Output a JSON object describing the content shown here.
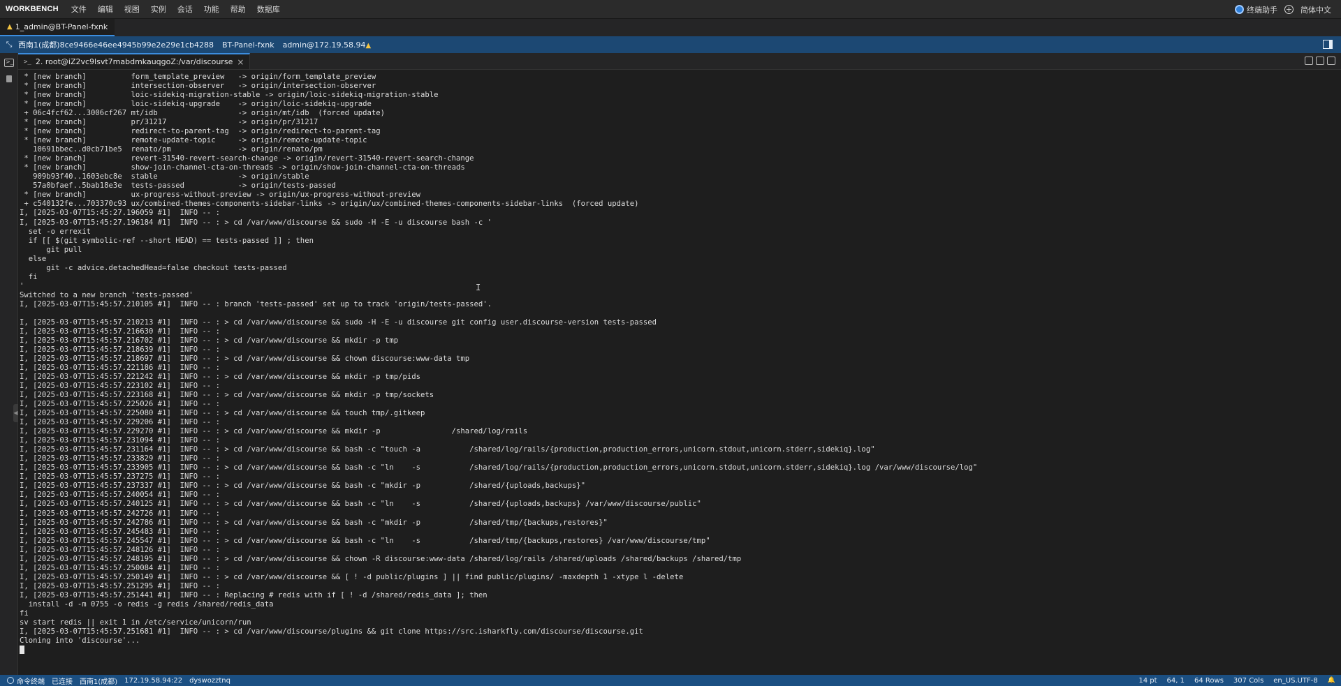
{
  "app": {
    "brand": "WORKBENCH",
    "menu": [
      "文件",
      "编辑",
      "视图",
      "实例",
      "会话",
      "功能",
      "帮助",
      "数据库"
    ],
    "assistant_label": "终端助手",
    "language": "简体中文"
  },
  "session_tab": {
    "label": "1_admin@BT-Panel-fxnk"
  },
  "infobar": {
    "region_instance": "西南1(成都)8ce9466e46ee4945b99e2e29e1cb4288",
    "panel_name": "BT-Panel-fxnk",
    "user_ip": "admin@172.19.58.94"
  },
  "terminal_tab": {
    "prompt": ">_",
    "label": "2. root@iZ2vc9lsvt7mabdmkauqgoZ:/var/discourse"
  },
  "terminal": {
    "lines": [
      " * [new branch]          form_template_preview   -> origin/form_template_preview",
      " * [new branch]          intersection-observer   -> origin/intersection-observer",
      " * [new branch]          loic-sidekiq-migration-stable -> origin/loic-sidekiq-migration-stable",
      " * [new branch]          loic-sidekiq-upgrade    -> origin/loic-sidekiq-upgrade",
      " + 06c4fcf62...3006cf267 mt/idb                  -> origin/mt/idb  (forced update)",
      " * [new branch]          pr/31217                -> origin/pr/31217",
      " * [new branch]          redirect-to-parent-tag  -> origin/redirect-to-parent-tag",
      " * [new branch]          remote-update-topic     -> origin/remote-update-topic",
      "   10691bbec..d0cb71be5  renato/pm               -> origin/renato/pm",
      " * [new branch]          revert-31540-revert-search-change -> origin/revert-31540-revert-search-change",
      " * [new branch]          show-join-channel-cta-on-threads -> origin/show-join-channel-cta-on-threads",
      "   909b93f40..1603ebc8e  stable                  -> origin/stable",
      "   57a0bfaef..5bab18e3e  tests-passed            -> origin/tests-passed",
      " * [new branch]          ux-progress-without-preview -> origin/ux-progress-without-preview",
      " + c540132fe...703370c93 ux/combined-themes-components-sidebar-links -> origin/ux/combined-themes-components-sidebar-links  (forced update)",
      "I, [2025-03-07T15:45:27.196059 #1]  INFO -- : ",
      "I, [2025-03-07T15:45:27.196184 #1]  INFO -- : > cd /var/www/discourse && sudo -H -E -u discourse bash -c '",
      "  set -o errexit",
      "  if [[ $(git symbolic-ref --short HEAD) == tests-passed ]] ; then",
      "      git pull",
      "  else",
      "      git -c advice.detachedHead=false checkout tests-passed",
      "  fi",
      "'",
      "Switched to a new branch 'tests-passed'",
      "I, [2025-03-07T15:45:57.210105 #1]  INFO -- : branch 'tests-passed' set up to track 'origin/tests-passed'.",
      "",
      "I, [2025-03-07T15:45:57.210213 #1]  INFO -- : > cd /var/www/discourse && sudo -H -E -u discourse git config user.discourse-version tests-passed",
      "I, [2025-03-07T15:45:57.216630 #1]  INFO -- : ",
      "I, [2025-03-07T15:45:57.216702 #1]  INFO -- : > cd /var/www/discourse && mkdir -p tmp",
      "I, [2025-03-07T15:45:57.218639 #1]  INFO -- : ",
      "I, [2025-03-07T15:45:57.218697 #1]  INFO -- : > cd /var/www/discourse && chown discourse:www-data tmp",
      "I, [2025-03-07T15:45:57.221186 #1]  INFO -- : ",
      "I, [2025-03-07T15:45:57.221242 #1]  INFO -- : > cd /var/www/discourse && mkdir -p tmp/pids",
      "I, [2025-03-07T15:45:57.223102 #1]  INFO -- : ",
      "I, [2025-03-07T15:45:57.223168 #1]  INFO -- : > cd /var/www/discourse && mkdir -p tmp/sockets",
      "I, [2025-03-07T15:45:57.225026 #1]  INFO -- : ",
      "I, [2025-03-07T15:45:57.225080 #1]  INFO -- : > cd /var/www/discourse && touch tmp/.gitkeep",
      "I, [2025-03-07T15:45:57.229206 #1]  INFO -- : ",
      "I, [2025-03-07T15:45:57.229270 #1]  INFO -- : > cd /var/www/discourse && mkdir -p                /shared/log/rails",
      "I, [2025-03-07T15:45:57.231094 #1]  INFO -- : ",
      "I, [2025-03-07T15:45:57.231164 #1]  INFO -- : > cd /var/www/discourse && bash -c \"touch -a           /shared/log/rails/{production,production_errors,unicorn.stdout,unicorn.stderr,sidekiq}.log\"",
      "I, [2025-03-07T15:45:57.233829 #1]  INFO -- : ",
      "I, [2025-03-07T15:45:57.233905 #1]  INFO -- : > cd /var/www/discourse && bash -c \"ln    -s           /shared/log/rails/{production,production_errors,unicorn.stdout,unicorn.stderr,sidekiq}.log /var/www/discourse/log\"",
      "I, [2025-03-07T15:45:57.237275 #1]  INFO -- : ",
      "I, [2025-03-07T15:45:57.237337 #1]  INFO -- : > cd /var/www/discourse && bash -c \"mkdir -p           /shared/{uploads,backups}\"",
      "I, [2025-03-07T15:45:57.240054 #1]  INFO -- : ",
      "I, [2025-03-07T15:45:57.240125 #1]  INFO -- : > cd /var/www/discourse && bash -c \"ln    -s           /shared/{uploads,backups} /var/www/discourse/public\"",
      "I, [2025-03-07T15:45:57.242726 #1]  INFO -- : ",
      "I, [2025-03-07T15:45:57.242786 #1]  INFO -- : > cd /var/www/discourse && bash -c \"mkdir -p           /shared/tmp/{backups,restores}\"",
      "I, [2025-03-07T15:45:57.245483 #1]  INFO -- : ",
      "I, [2025-03-07T15:45:57.245547 #1]  INFO -- : > cd /var/www/discourse && bash -c \"ln    -s           /shared/tmp/{backups,restores} /var/www/discourse/tmp\"",
      "I, [2025-03-07T15:45:57.248126 #1]  INFO -- : ",
      "I, [2025-03-07T15:45:57.248195 #1]  INFO -- : > cd /var/www/discourse && chown -R discourse:www-data /shared/log/rails /shared/uploads /shared/backups /shared/tmp",
      "I, [2025-03-07T15:45:57.250084 #1]  INFO -- : ",
      "I, [2025-03-07T15:45:57.250149 #1]  INFO -- : > cd /var/www/discourse && [ ! -d public/plugins ] || find public/plugins/ -maxdepth 1 -xtype l -delete",
      "I, [2025-03-07T15:45:57.251295 #1]  INFO -- : ",
      "I, [2025-03-07T15:45:57.251441 #1]  INFO -- : Replacing # redis with if [ ! -d /shared/redis_data ]; then",
      "  install -d -m 0755 -o redis -g redis /shared/redis_data",
      "fi",
      "sv start redis || exit 1 in /etc/service/unicorn/run",
      "I, [2025-03-07T15:45:57.251681 #1]  INFO -- : > cd /var/www/discourse/plugins && git clone https://src.isharkfly.com/discourse/discourse.git",
      "Cloning into 'discourse'..."
    ]
  },
  "statusbar": {
    "left": [
      "命令终端",
      "已连接",
      "西南1(成都)",
      "172.19.58.94:22",
      "dyswozztnq"
    ],
    "font_size": "14 pt",
    "cursor_pos": "64, 1",
    "rows": "64 Rows",
    "cols": "307 Cols",
    "encoding": "en_US.UTF-8"
  }
}
